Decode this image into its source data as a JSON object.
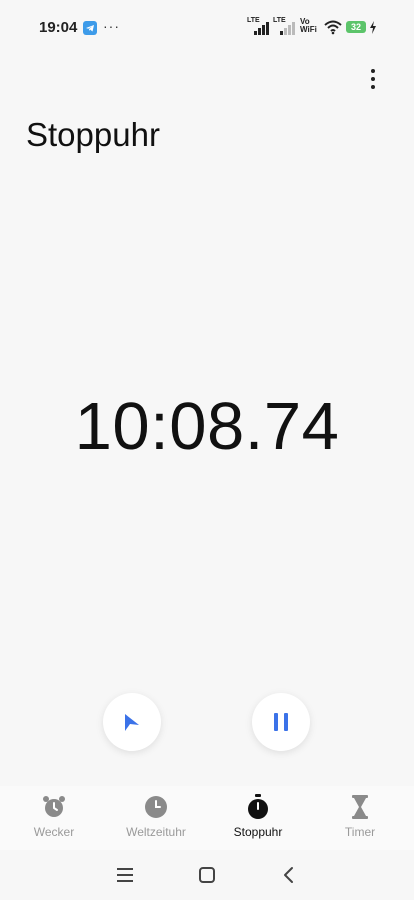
{
  "status_bar": {
    "time": "19:04",
    "more": "···",
    "sim1": "LTE",
    "sim2": "LTE",
    "vowifi_line1": "Vo",
    "vowifi_line2": "WiFi",
    "battery": "32",
    "icons": [
      "telegram-icon",
      "signal-icon",
      "signal-icon",
      "wifi-icon",
      "battery-icon",
      "charging-icon"
    ],
    "battery_color": "#5cc46a"
  },
  "header": {
    "title": "Stoppuhr",
    "menu_icon": "more-vertical-icon"
  },
  "stopwatch": {
    "time": "10:08.74"
  },
  "controls": {
    "lap_icon": "flag-icon",
    "pause_icon": "pause-icon",
    "accent": "#3b72e8"
  },
  "bottom_nav": {
    "items": [
      {
        "label": "Wecker",
        "icon": "alarm-clock-icon",
        "active": false
      },
      {
        "label": "Weltzeituhr",
        "icon": "clock-icon",
        "active": false
      },
      {
        "label": "Stoppuhr",
        "icon": "stopwatch-icon",
        "active": true
      },
      {
        "label": "Timer",
        "icon": "hourglass-icon",
        "active": false
      }
    ]
  },
  "system_nav": {
    "icons": [
      "menu-icon",
      "home-icon",
      "back-icon"
    ]
  }
}
